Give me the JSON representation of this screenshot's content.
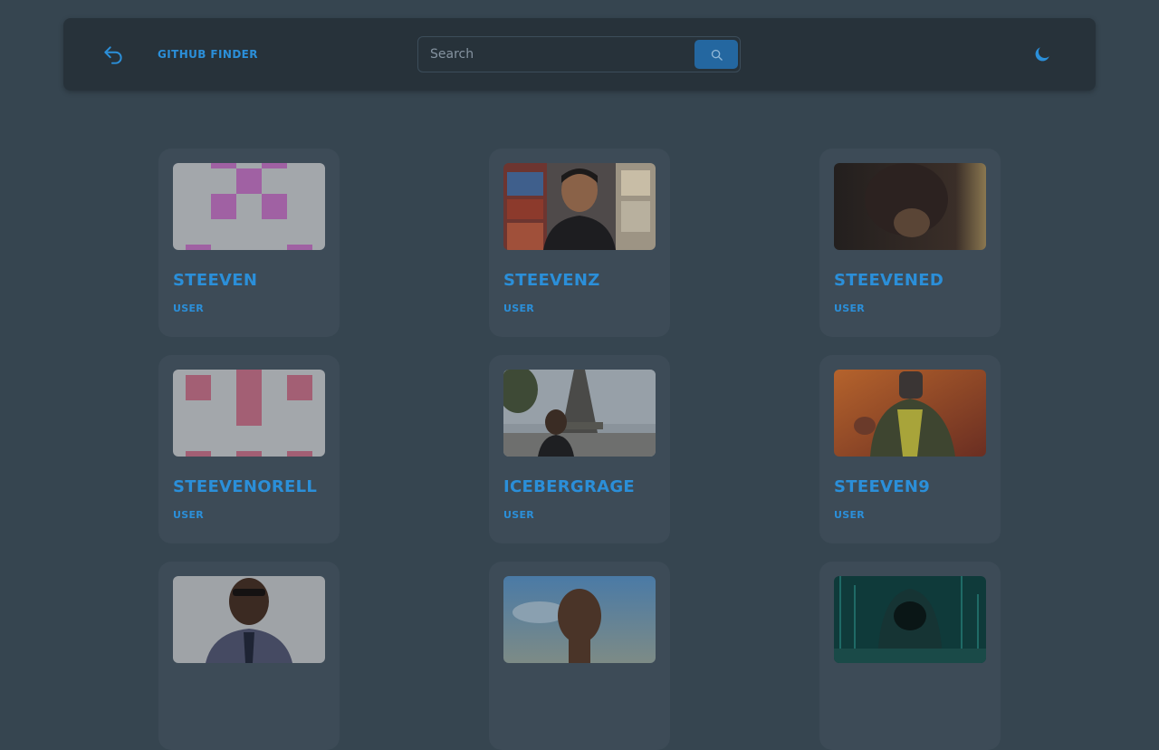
{
  "navbar": {
    "brand": "GITHUB FINDER",
    "search": {
      "placeholder": "Search",
      "value": ""
    },
    "icons": {
      "back": "undo-arrow-icon",
      "search": "search-icon",
      "theme": "moon-icon"
    }
  },
  "colors": {
    "background": "#364550",
    "navbar": "#27323a",
    "card": "#3d4b57",
    "accent": "#2b8fd9",
    "search_button": "#2467a0"
  },
  "users": [
    {
      "login": "STEEVEN",
      "type": "USER"
    },
    {
      "login": "STEEVENZ",
      "type": "USER"
    },
    {
      "login": "STEEVENED",
      "type": "USER"
    },
    {
      "login": "STEEVENORELL",
      "type": "USER"
    },
    {
      "login": "ICEBERGRAGE",
      "type": "USER"
    },
    {
      "login": "STEEVEN9",
      "type": "USER"
    },
    {
      "login": "",
      "type": ""
    },
    {
      "login": "",
      "type": ""
    },
    {
      "login": "",
      "type": ""
    }
  ]
}
